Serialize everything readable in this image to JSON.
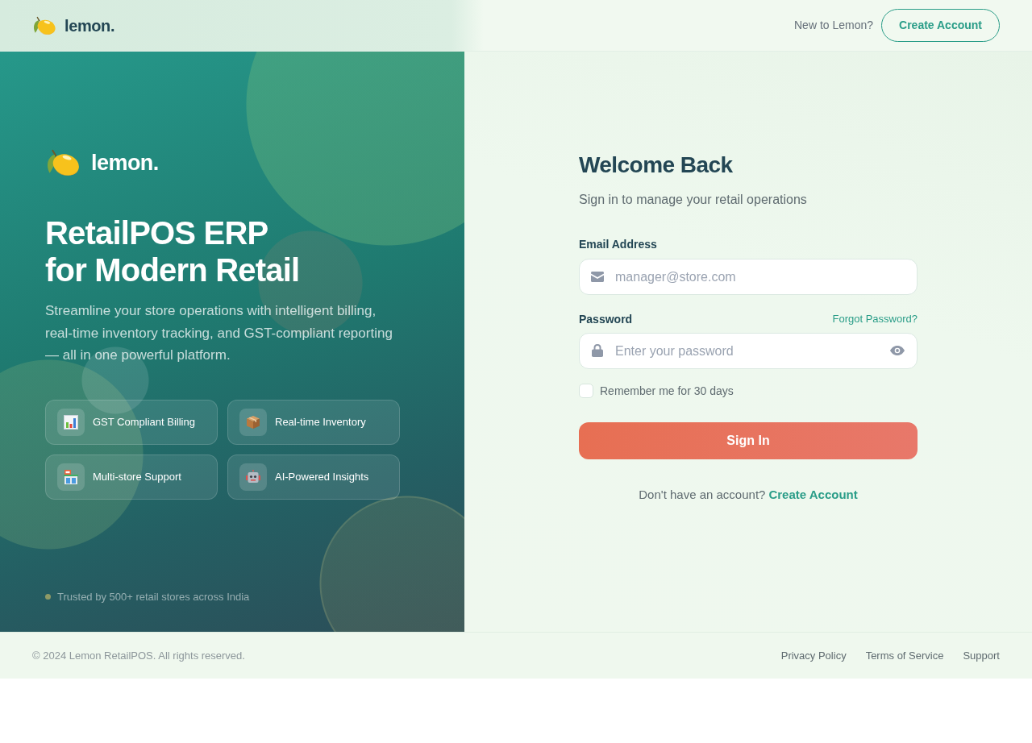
{
  "header": {
    "logo": "lemon.",
    "prompt": "New to Lemon?",
    "create_account": "Create Account"
  },
  "hero": {
    "logo": "lemon.",
    "title_lines": [
      "RetailPOS ERP",
      "for Modern Retail"
    ],
    "description": "Streamline your store operations with intelligent billing, real-time inventory tracking, and GST-compliant reporting — all in one powerful platform.",
    "features": [
      {
        "label": "GST Compliant Billing"
      },
      {
        "label": "Real-time Inventory"
      },
      {
        "label": "Multi-store Support"
      },
      {
        "label": "AI-Powered Insights"
      }
    ],
    "trust_note": "Trusted by 500+ retail stores across India"
  },
  "form": {
    "title": "Welcome Back",
    "subtitle": "Sign in to manage your retail operations",
    "fields": [
      {
        "kind": "email",
        "label": "Email Address",
        "placeholder": "manager@store.com"
      },
      {
        "kind": "password",
        "label": "Password",
        "link": "Forgot Password?",
        "placeholder": "Enter your password"
      }
    ],
    "remember": {
      "label": "Remember me for 30 days",
      "checked": false
    },
    "submit": "Sign In",
    "signup_prompt": "Don't have an account?",
    "signup_link": "Create Account"
  },
  "footer": {
    "copyright": "© 2024 Lemon RetailPOS. All rights reserved.",
    "links": [
      "Privacy Policy",
      "Terms of Service",
      "Support"
    ]
  }
}
